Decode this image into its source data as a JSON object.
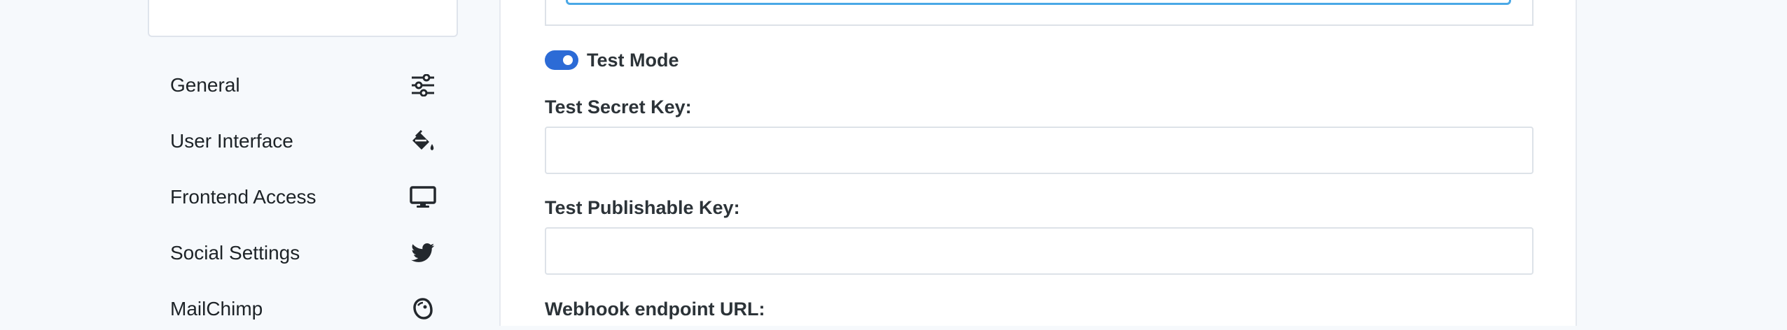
{
  "sidebar": {
    "items": [
      {
        "label": "General",
        "icon": "sliders-icon"
      },
      {
        "label": "User Interface",
        "icon": "paint-bucket-icon"
      },
      {
        "label": "Frontend Access",
        "icon": "desktop-icon"
      },
      {
        "label": "Social Settings",
        "icon": "twitter-icon"
      },
      {
        "label": "MailChimp",
        "icon": "mailchimp-icon"
      }
    ]
  },
  "form": {
    "test_mode": {
      "label": "Test Mode",
      "enabled": true
    },
    "test_secret_key": {
      "label": "Test Secret Key:",
      "value": ""
    },
    "test_publishable_key": {
      "label": "Test Publishable Key:",
      "value": ""
    },
    "webhook_endpoint_url": {
      "label": "Webhook endpoint URL:"
    }
  },
  "colors": {
    "accent": "#2c6bd6",
    "focus_border": "#4aa8e6",
    "page_background": "#f6f9fc",
    "text": "#1d2327"
  }
}
